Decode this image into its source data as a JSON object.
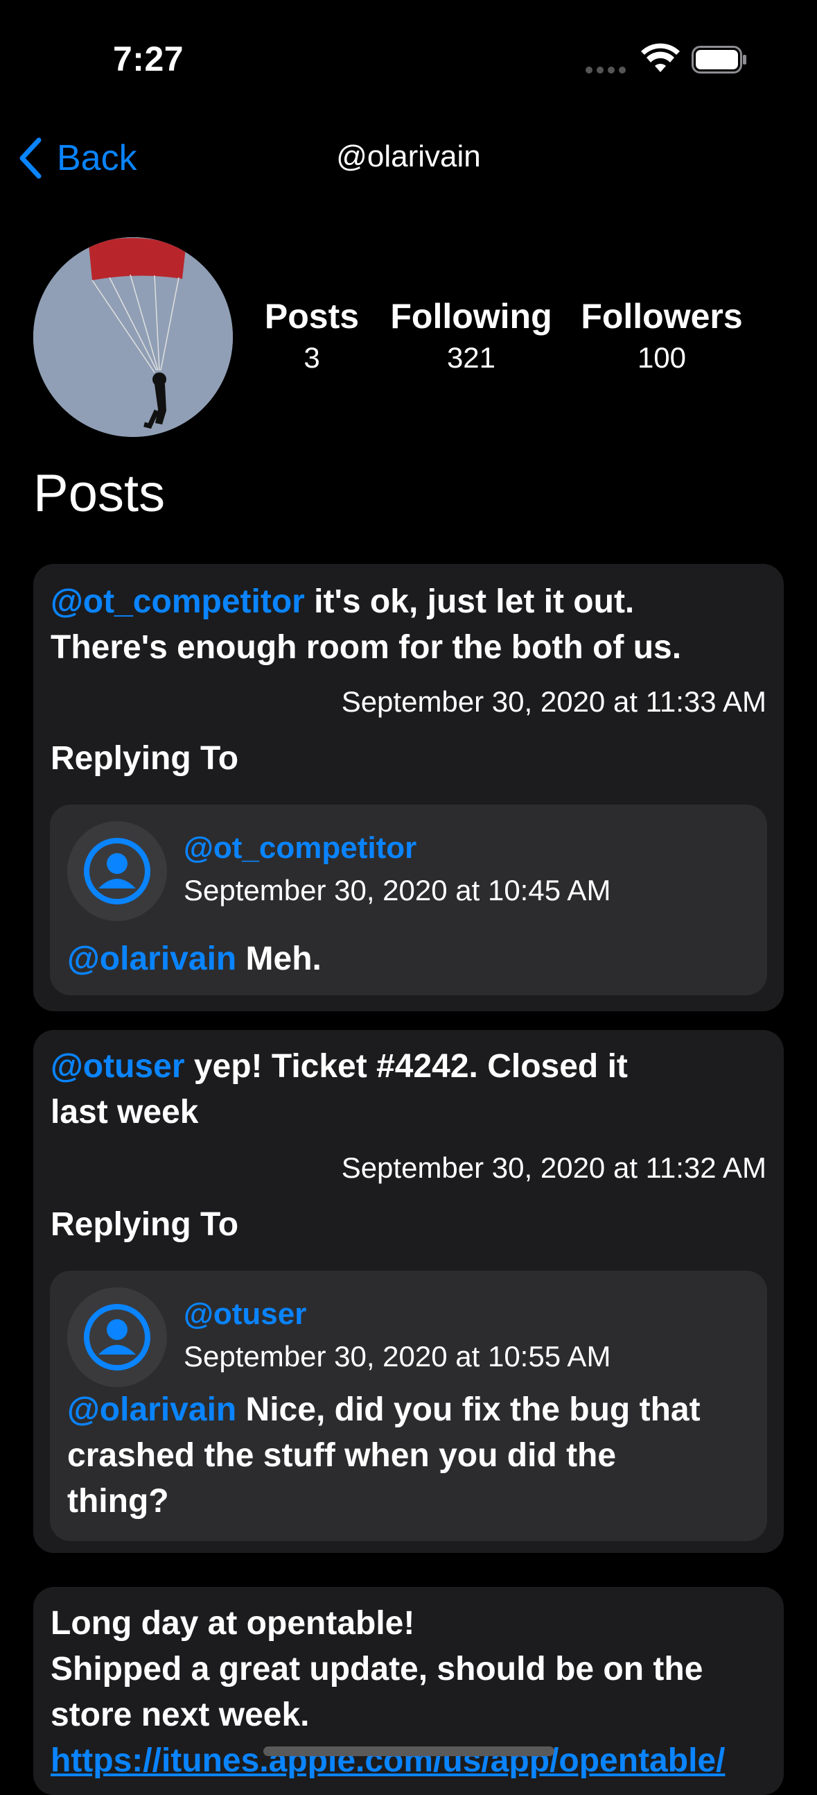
{
  "status": {
    "time": "7:27"
  },
  "nav": {
    "back_label": "Back",
    "title": "@olarivain"
  },
  "profile": {
    "stats": [
      {
        "label": "Posts",
        "value": "3"
      },
      {
        "label": "Following",
        "value": "321"
      },
      {
        "label": "Followers",
        "value": "100"
      }
    ]
  },
  "section_title": "Posts",
  "posts": [
    {
      "mention": "@ot_competitor",
      "text_line1": " it's ok, just let it out.",
      "text_line2": "There's enough room for the both of us.",
      "date": "September 30, 2020 at 11:33 AM",
      "replying_label": "Replying To",
      "reply": {
        "handle": "@ot_competitor",
        "date": "September 30, 2020 at 10:45 AM",
        "mention": "@olarivain",
        "text": " Meh."
      }
    },
    {
      "mention": "@otuser",
      "text_line1": " yep! Ticket #4242. Closed it",
      "text_line2": "last week",
      "date": "September 30, 2020 at 11:32 AM",
      "replying_label": "Replying To",
      "reply": {
        "handle": "@otuser",
        "date": "September 30, 2020 at 10:55 AM",
        "mention": "@olarivain",
        "text_line1": " Nice, did you fix the bug that",
        "text_line2": "crashed the stuff when you did the",
        "text_line3": "thing?"
      }
    },
    {
      "text_line1": "Long day at opentable!",
      "text_line2": "Shipped a great update, should be on the",
      "text_line3": "store next week.",
      "link": "https://itunes.apple.com/us/app/opentable/"
    }
  ],
  "colors": {
    "accent": "#0a84ff",
    "card": "#1c1c1e",
    "reply_card": "#2c2c2e",
    "background": "#000000"
  }
}
